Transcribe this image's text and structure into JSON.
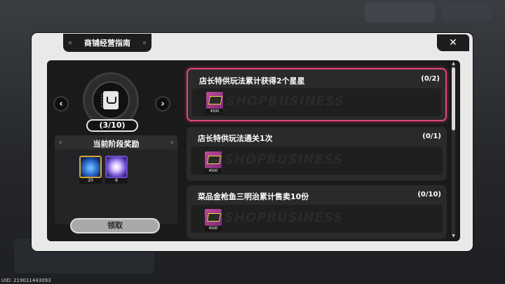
{
  "window": {
    "title": "商铺经营指南",
    "close_icon": "close-icon"
  },
  "badge": {
    "icon": "notebook-coffee-icon",
    "progress": "(3/10)"
  },
  "stage_rewards": {
    "title": "当前阶段奖励",
    "items": [
      {
        "icon": "blue-orb-icon",
        "count": "20"
      },
      {
        "icon": "purple-orb-icon",
        "count": "6"
      }
    ],
    "claim_label": "领取"
  },
  "tasks": [
    {
      "title": "店长特供玩法累计获得2个星星",
      "progress": "(0/2)",
      "reward_icon": "ticket-icon",
      "reward_count": "4500",
      "watermark": "SHOPBUSINESS",
      "highlighted": true
    },
    {
      "title": "店长特供玩法通关1次",
      "progress": "(0/1)",
      "reward_icon": "ticket-icon",
      "reward_count": "4500",
      "watermark": "SHOPBUSINESS",
      "highlighted": false
    },
    {
      "title": "菜品金枪鱼三明治累计售卖10份",
      "progress": "(0/10)",
      "reward_icon": "ticket-icon",
      "reward_count": "4500",
      "watermark": "SHOPBUSINESS",
      "highlighted": false
    }
  ],
  "footer": {
    "uid": "UID: 219011443093"
  },
  "colors": {
    "highlight": "#e0457b",
    "panel": "#e9e9e9",
    "inner": "#1a1a1b"
  }
}
